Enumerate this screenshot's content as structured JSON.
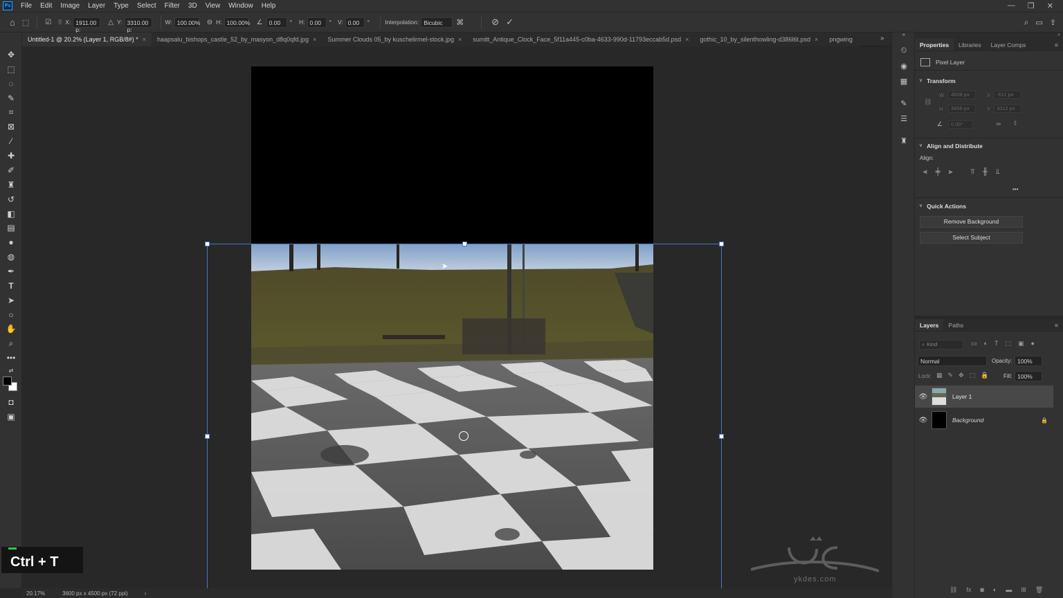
{
  "app": {
    "logo": "Ps"
  },
  "menu": [
    "File",
    "Edit",
    "Image",
    "Layer",
    "Type",
    "Select",
    "Filter",
    "3D",
    "View",
    "Window",
    "Help"
  ],
  "window_controls": [
    "—",
    "❐",
    "✕"
  ],
  "options": {
    "x_label": "X:",
    "x_value": "1911.00 p:",
    "y_label": "Y:",
    "y_value": "3310.00 p:",
    "w_label": "W:",
    "w_value": "100.00%",
    "h_label": "H:",
    "h_value": "100.00%",
    "angle_value": "0.00",
    "hskew_label": "H:",
    "hskew_value": "0.00",
    "vskew_label": "V:",
    "vskew_value": "0.00",
    "deg": "°",
    "interp_label": "Interpolation:",
    "interp_value": "Bicubic"
  },
  "tabs": [
    {
      "label": "Untitled-1 @ 20.2% (Layer 1, RGB/8#) *",
      "active": true
    },
    {
      "label": "haapsalu_bishops_castle_52_by_masyon_d8q0qfd.jpg",
      "active": false
    },
    {
      "label": "Summer Clouds 05_by kuschelirmel-stock.jpg",
      "active": false
    },
    {
      "label": "sumitt_Antique_Clock_Face_5f11a445-c0ba-4633-990d-11793eccab5d.psd",
      "active": false
    },
    {
      "label": "gothic_10_by_silenthowling-d386l6t.psd",
      "active": false
    },
    {
      "label": "pngwing",
      "active": false
    }
  ],
  "tab_close": "×",
  "status": {
    "zoom": "20.17%",
    "doc_info": "3600 px x 4500 px (72 ppi)"
  },
  "overlay": {
    "shortcut": "Ctrl + T"
  },
  "watermark": {
    "text": "ykdes.com"
  },
  "properties": {
    "tabs": [
      "Properties",
      "Libraries",
      "Layer Comps"
    ],
    "kind": "Pixel Layer",
    "transform_title": "Transform",
    "w_label": "W",
    "w_value": "4608 px",
    "x_label": "X",
    "x_value": "-611 px",
    "h_label": "H",
    "h_value": "3456 px",
    "y_label": "Y",
    "y_value": "1012 px",
    "angle_value": "0.00°",
    "align_title": "Align and Distribute",
    "align_label": "Align:",
    "more": "•••",
    "quick_title": "Quick Actions",
    "remove_bg": "Remove Background",
    "select_subject": "Select Subject"
  },
  "layers": {
    "tabs": [
      "Layers",
      "Paths"
    ],
    "kind_placeholder": "Kind",
    "blend_mode": "Normal",
    "opacity_label": "Opacity:",
    "opacity_value": "100%",
    "lock_label": "Lock:",
    "fill_label": "Fill:",
    "fill_value": "100%",
    "items": [
      {
        "name": "Layer 1",
        "selected": true
      },
      {
        "name": "Background",
        "selected": false
      }
    ]
  },
  "colors": {
    "accent": "#4a78c2",
    "bg": "#282828",
    "panel": "#323232"
  }
}
